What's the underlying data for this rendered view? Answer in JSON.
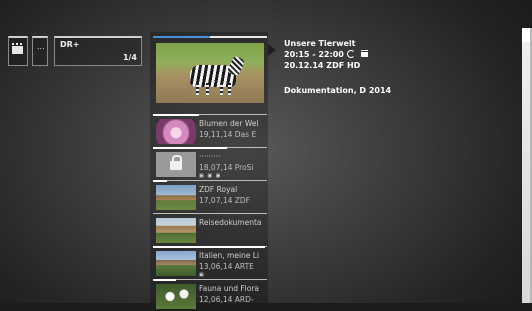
{
  "top_cards": {
    "card3": {
      "channel": "DR+",
      "page": "1/4"
    },
    "card2_label": "..."
  },
  "list": {
    "featured": {
      "progress": 0.5
    },
    "rows": [
      {
        "title": "Blumen der Wel",
        "subtitle": "19,11,14 Das E",
        "thumb": "flower",
        "progress": 0.4
      },
      {
        "title": "·········",
        "subtitle": "18,07,14 ProSi",
        "thumb": "locked",
        "icons": "▣ ▣ ▣",
        "progress": 0.65
      },
      {
        "title": "ZDF Royal",
        "subtitle": "17,07,14 ZDF",
        "thumb": "palace",
        "progress": 0.12
      },
      {
        "title": "Reisedokumenta",
        "subtitle": "",
        "thumb": "village",
        "progress": 0
      },
      {
        "title": "Italien, meine Li",
        "subtitle": "13,06,14 ARTE",
        "thumb": "italy",
        "icons": "▣",
        "progress": 0.98
      },
      {
        "title": "Fauna und Flora",
        "subtitle": "12,06,14 ARD-",
        "thumb": "flowers2",
        "progress": 0.2
      }
    ]
  },
  "info": {
    "title": "Unsere Tierwelt",
    "time": "20:15 - 22:00",
    "date_channel": "20.12.14  ZDF HD",
    "genre": "Dokumentation, D 2014",
    "icons": [
      "repeat-icon",
      "record-icon"
    ]
  }
}
